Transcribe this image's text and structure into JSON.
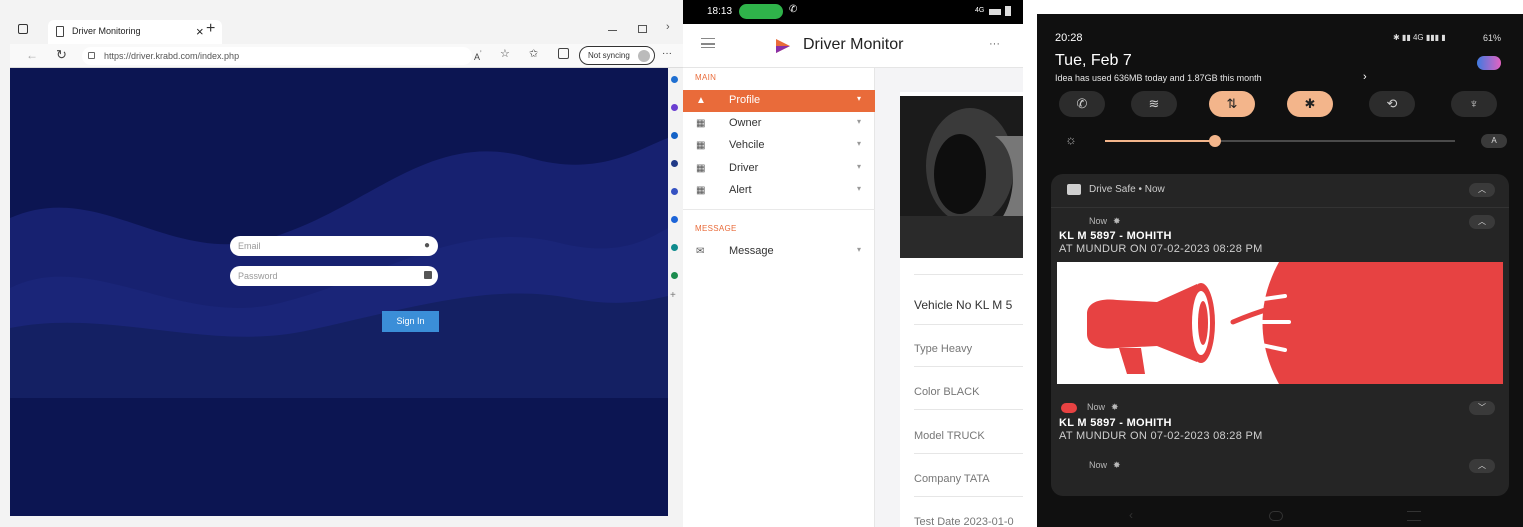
{
  "browser": {
    "tab_title": "Driver Monitoring",
    "tab_close": "×",
    "new_tab": "+",
    "url": "https://driver.krabd.com/index.php",
    "sync_label": "Not syncing",
    "more": "···",
    "login": {
      "email_placeholder": "Email",
      "password_placeholder": "Password",
      "signin_label": "Sign In"
    }
  },
  "phone_web": {
    "status": {
      "time": "18:13",
      "signal": "4G"
    },
    "app_title": "Driver Monitor",
    "more": "···",
    "sections": {
      "main": "MAIN",
      "message": "MESSAGE"
    },
    "menu": [
      {
        "label": "Profile",
        "active": true
      },
      {
        "label": "Owner"
      },
      {
        "label": "Vehcile"
      },
      {
        "label": "Driver"
      },
      {
        "label": "Alert"
      }
    ],
    "message_item": "Message",
    "details": {
      "vehicle": "Vehicle No KL M 5",
      "type": "Type Heavy",
      "color": "Color BLACK",
      "model": "Model TRUCK",
      "company": "Company TATA",
      "test_date": "Test Date 2023-01-0"
    }
  },
  "android": {
    "time": "20:28",
    "battery": "61%",
    "date": "Tue, Feb 7",
    "data_usage": "Idea has used 636MB today and 1.87GB this month",
    "auto": "A",
    "app_name": "Drive Safe • Now",
    "notifications": [
      {
        "time": "Now",
        "title": "KL M 5897 - MOHITH",
        "body": "AT MUNDUR ON 07-02-2023 08:28 PM"
      },
      {
        "time": "Now",
        "title": "KL M 5897 - MOHITH",
        "body": "AT MUNDUR ON 07-02-2023 08:28 PM"
      },
      {
        "time": "Now"
      }
    ],
    "colors": {
      "alert_red": "#e74242",
      "qs_active": "#f3b58b"
    }
  }
}
